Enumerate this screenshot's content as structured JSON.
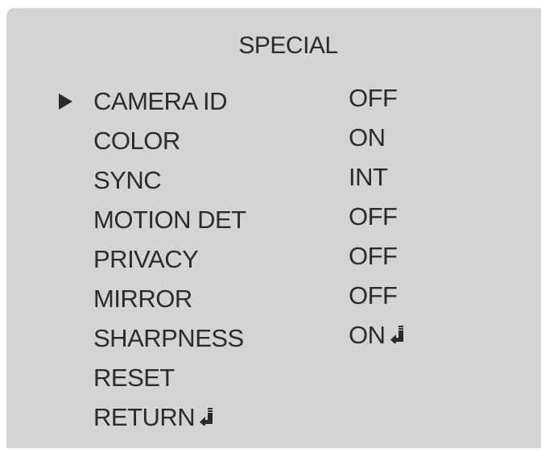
{
  "title": "SPECIAL",
  "cursor_icon": "triangle-right-icon",
  "enter_icon": "enter-return-icon",
  "menu": {
    "items": [
      {
        "label": "CAMERA ID",
        "value": "OFF"
      },
      {
        "label": "COLOR",
        "value": "ON"
      },
      {
        "label": "SYNC",
        "value": "INT"
      },
      {
        "label": "MOTION DET",
        "value": "OFF"
      },
      {
        "label": "PRIVACY",
        "value": "OFF"
      },
      {
        "label": "MIRROR",
        "value": "OFF"
      },
      {
        "label": "SHARPNESS",
        "value": "ON"
      },
      {
        "label": "RESET",
        "value": ""
      },
      {
        "label": "RETURN",
        "value": ""
      }
    ]
  },
  "colors": {
    "panel_background": "#d4d4d5",
    "text": "#2b2b2b"
  }
}
